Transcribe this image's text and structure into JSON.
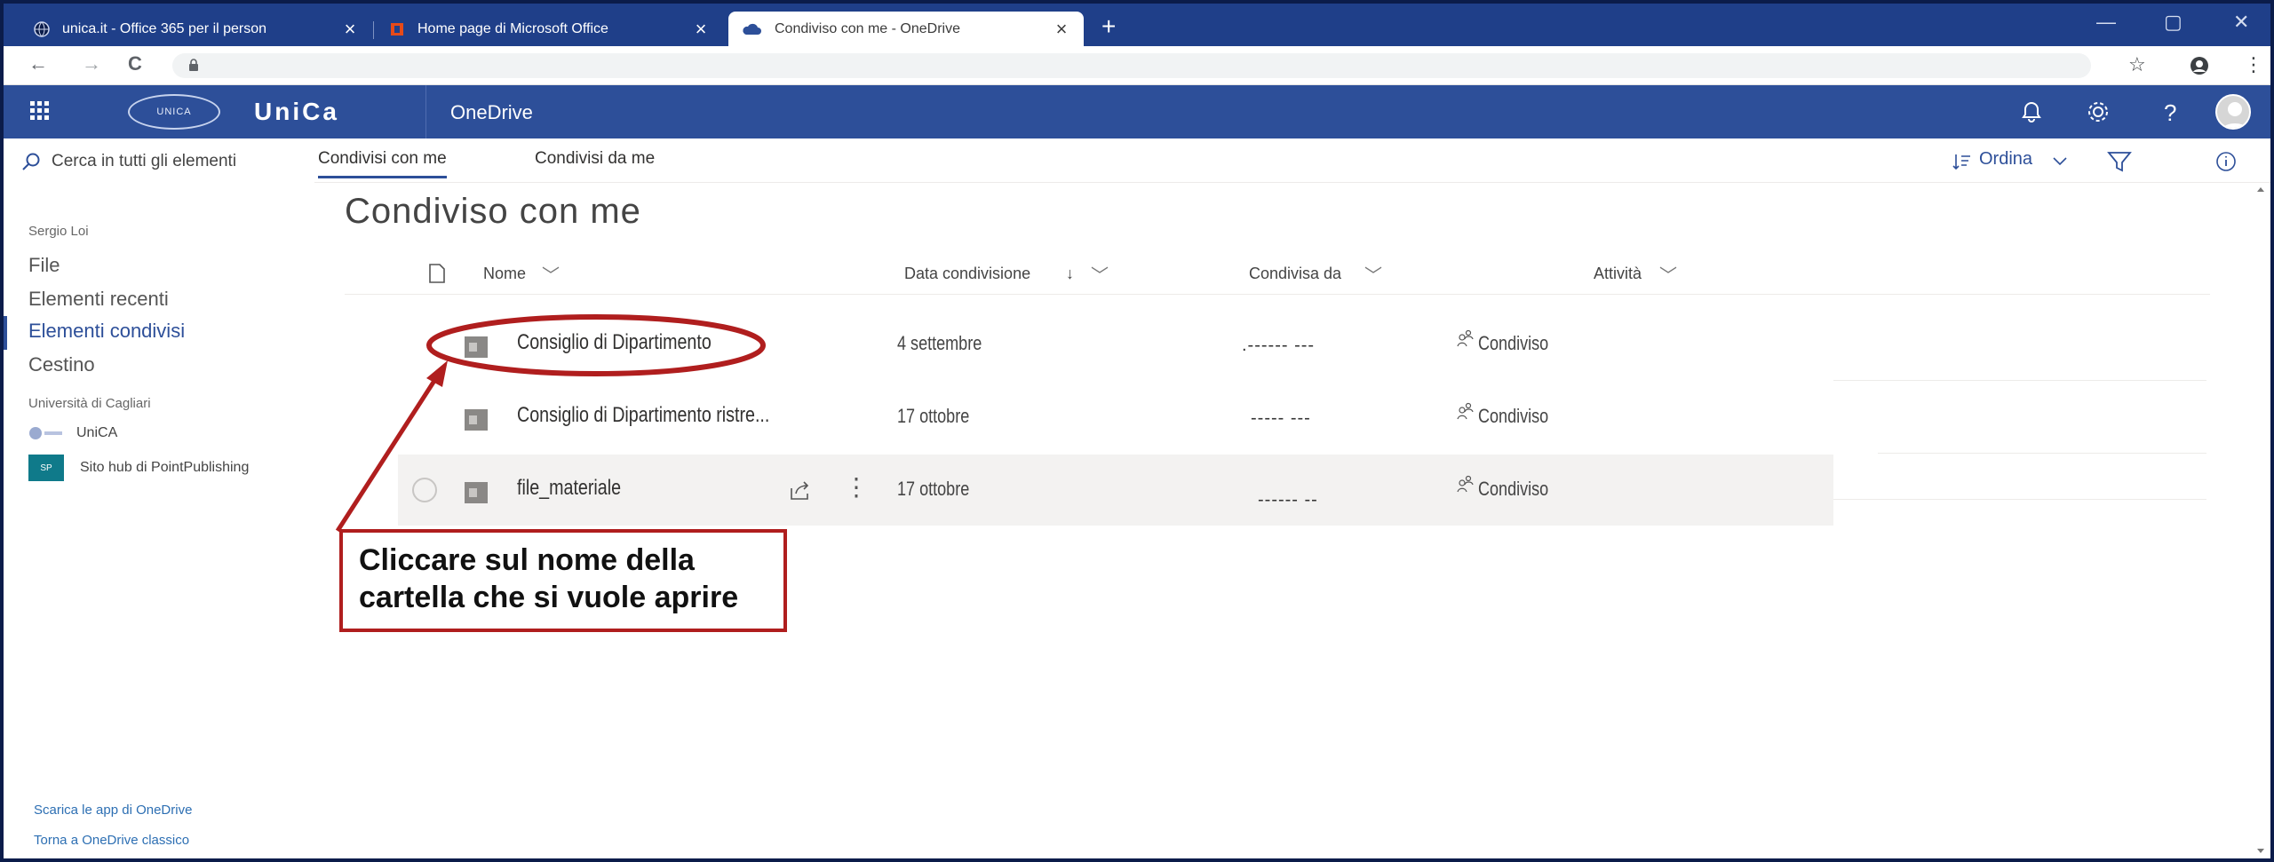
{
  "browser": {
    "tabs": [
      {
        "title": "unica.it - Office 365 per il person",
        "active": false
      },
      {
        "title": "Home page di Microsoft Office",
        "active": false
      },
      {
        "title": "Condiviso con me - OneDrive",
        "active": true
      }
    ],
    "new_tab": "+",
    "window_controls": [
      "—",
      "▢",
      "✕"
    ],
    "nav": {
      "back": "←",
      "forward": "→",
      "reload": "C"
    },
    "right_icons": [
      "☆",
      "⋮"
    ]
  },
  "suite": {
    "brand": "UniCa",
    "seal_text": "UNICA",
    "app_name": "OneDrive"
  },
  "leftnav": {
    "search_placeholder": "Cerca in tutti gli elementi",
    "user": "Sergio Loi",
    "items": [
      {
        "label": "File",
        "active": false
      },
      {
        "label": "Elementi recenti",
        "active": false
      },
      {
        "label": "Elementi condivisi",
        "active": true
      },
      {
        "label": "Cestino",
        "active": false
      }
    ],
    "org": "Università di Cagliari",
    "sites": [
      {
        "badge": "",
        "label": "UniCA"
      },
      {
        "badge": "SP",
        "label": "Sito hub di PointPublishing"
      }
    ],
    "footer": [
      "Scarica le app di OneDrive",
      "Torna a OneDrive classico"
    ]
  },
  "commandbar": {
    "pivots": [
      {
        "label": "Condivisi con me",
        "active": true
      },
      {
        "label": "Condivisi da me",
        "active": false
      }
    ],
    "sort_label": "Ordina"
  },
  "main": {
    "title": "Condiviso con me",
    "columns": {
      "name": "Nome",
      "date": "Data condivisione",
      "sharedby": "Condivisa da",
      "activity": "Attività"
    },
    "rows": [
      {
        "name": "Consiglio di Dipartimento",
        "date": "4 settembre",
        "sharedby": ".------ ---",
        "activity": "Condiviso"
      },
      {
        "name": "Consiglio di Dipartimento ristre...",
        "date": "17 ottobre",
        "sharedby": "----- ---",
        "activity": "Condiviso"
      },
      {
        "name": "file_materiale",
        "date": "17 ottobre",
        "sharedby": "------ --",
        "activity": "Condiviso"
      }
    ]
  },
  "annotation": {
    "line1": "Cliccare sul nome della",
    "line2": "cartella che si vuole aprire",
    "color": "#b01e1e"
  }
}
